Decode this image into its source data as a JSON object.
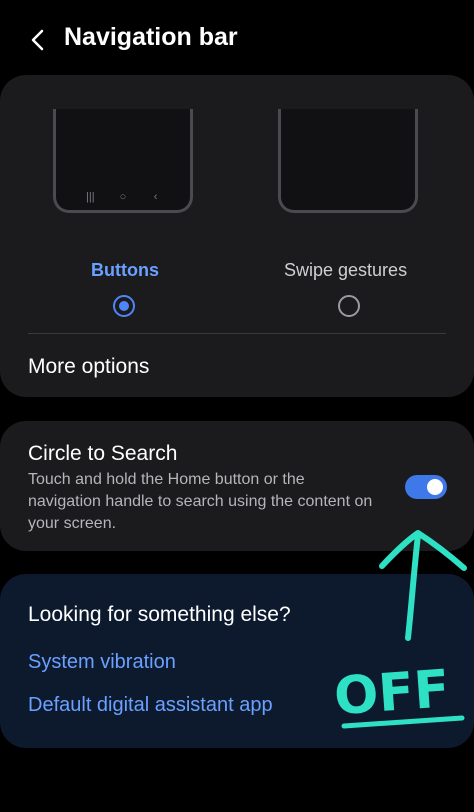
{
  "header": {
    "title": "Navigation bar",
    "back_icon": "chevron-left-icon"
  },
  "nav_types": {
    "options": [
      {
        "label": "Buttons",
        "selected": true
      },
      {
        "label": "Swipe gestures",
        "selected": false
      }
    ],
    "more_options": "More options"
  },
  "circle_to_search": {
    "title": "Circle to Search",
    "description": "Touch and hold the Home button or the navigation handle to search using the content on your screen.",
    "enabled": true
  },
  "looking_else": {
    "title": "Looking for something else?",
    "links": [
      "System vibration",
      "Default digital assistant app"
    ]
  },
  "annotation": {
    "text": "OFF",
    "color": "#2ee0c4"
  },
  "colors": {
    "accent": "#4f86f7",
    "background": "#000000",
    "card": "#1b1b1d"
  }
}
